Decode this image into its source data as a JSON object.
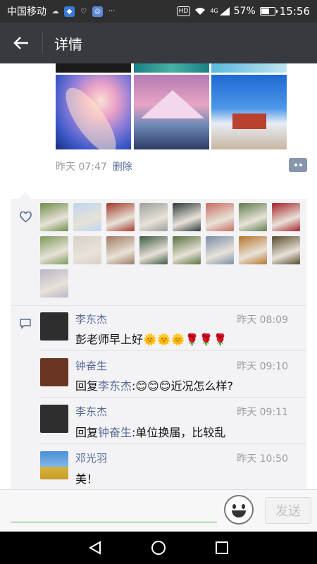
{
  "status_bar": {
    "carrier": "中国移动",
    "icons": [
      "cloud-icon",
      "app-icon",
      "shield-icon",
      "notification-icon",
      "more-icon"
    ],
    "right_icons": [
      "hd-badge",
      "wifi-icon",
      "signal-icon",
      "battery-icon"
    ],
    "hd_label": "HD",
    "network_label": "4G",
    "battery": "57%",
    "time": "15:56"
  },
  "header": {
    "back_icon": "back-arrow-icon",
    "title": "详情"
  },
  "post": {
    "photos": [
      "aurora",
      "snow-mountain",
      "tibet-palace"
    ],
    "time": "昨天 07:47",
    "delete_label": "删除",
    "comment_button_icon": "more-dots-icon"
  },
  "likes": {
    "icon": "heart-icon",
    "avatars": [
      "avatar-1",
      "avatar-2",
      "avatar-3",
      "avatar-4",
      "avatar-5",
      "avatar-6",
      "avatar-7",
      "avatar-8",
      "avatar-9",
      "avatar-10",
      "avatar-11",
      "avatar-12",
      "avatar-13",
      "avatar-14",
      "avatar-15",
      "avatar-16",
      "avatar-17"
    ],
    "avatar_colors": [
      "#6f8e4a",
      "#bcd7ef",
      "#a2392b",
      "#9ba09b",
      "#2d3a3d",
      "#c96a5f",
      "#5f7c4d",
      "#a6212b",
      "#7d9a5a",
      "#d8d0c8",
      "#9f7a64",
      "#3d5a42",
      "#58713f",
      "#7a8ea8",
      "#b7742b",
      "#57492c",
      "#b9b5c8"
    ]
  },
  "comments": {
    "icon": "comment-icon",
    "items": [
      {
        "name": "李东杰",
        "time": "昨天 08:09",
        "prefix": "",
        "reply_to": "",
        "text": "彭老师早上好🌞🌞🌞🌹🌹🌹",
        "avatar_color": "#2d2d2d"
      },
      {
        "name": "钟奋生",
        "time": "昨天 09:10",
        "prefix": "回复",
        "reply_to": "李东杰",
        "text": ":😊😊😊近况怎么样?",
        "avatar_color": "#6b3524"
      },
      {
        "name": "李东杰",
        "time": "昨天 09:11",
        "prefix": "回复",
        "reply_to": "钟奋生",
        "text": ":单位换届，比较乱",
        "avatar_color": "#2d2d2d"
      },
      {
        "name": "邓光羽",
        "time": "昨天 10:50",
        "prefix": "",
        "reply_to": "",
        "text": "美！",
        "avatar_color": "#4d8fd8"
      }
    ]
  },
  "input_bar": {
    "placeholder": "",
    "emoji_icon": "emoji-icon",
    "send_label": "发送"
  },
  "nav_bar": {
    "icons": [
      "back-triangle-icon",
      "home-circle-icon",
      "recents-square-icon"
    ]
  }
}
